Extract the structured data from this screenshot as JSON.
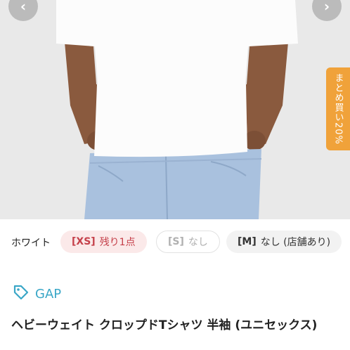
{
  "gallery": {
    "prev_icon": "chevron-left-icon",
    "next_icon": "chevron-right-icon",
    "prev_glyph": "‹",
    "next_glyph": "›"
  },
  "bulk_tab": {
    "label": "まとめ買い20%",
    "color": "#f0a23a"
  },
  "variants": {
    "color_label": "ホワイト",
    "sizes": [
      {
        "size": "[XS]",
        "status": "残り1点"
      },
      {
        "size": "[S]",
        "status": "なし"
      },
      {
        "size": "[M]",
        "status": "なし (店舗あり)"
      }
    ]
  },
  "product": {
    "brand": "GAP",
    "brand_icon": "tag-icon",
    "brand_color": "#3aa7c7",
    "title": "ヘビーウェイト クロップドTシャツ 半袖 (ユニセックス)"
  }
}
